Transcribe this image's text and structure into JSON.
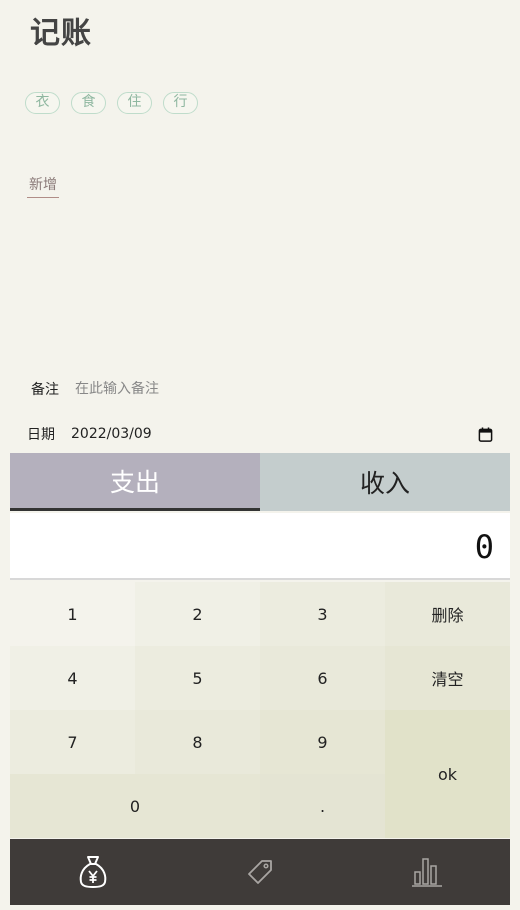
{
  "header": {
    "title": "记账"
  },
  "tags": [
    "衣",
    "食",
    "住",
    "行"
  ],
  "add_tag_label": "新增",
  "note": {
    "label": "备注",
    "placeholder": "在此输入备注"
  },
  "date": {
    "label": "日期",
    "value": "2022/03/09"
  },
  "type_tabs": {
    "expense": "支出",
    "income": "收入",
    "selected": "expense"
  },
  "amount_display": "0",
  "keypad": {
    "k1": "1",
    "k2": "2",
    "k3": "3",
    "delete": "删除",
    "k4": "4",
    "k5": "5",
    "k6": "6",
    "clear": "清空",
    "k7": "7",
    "k8": "8",
    "k9": "9",
    "ok": "ok",
    "k0": "0",
    "dot": "."
  },
  "nav": {
    "items": [
      "money-bag-icon",
      "tag-icon",
      "chart-icon"
    ],
    "active": "money-bag-icon"
  },
  "colors": {
    "background": "#f4f3ec",
    "expense_tab": "#b4b0bd",
    "income_tab": "#c4cdcd",
    "nav_bg": "#3f3b39",
    "tag_border": "#bfdccb"
  }
}
